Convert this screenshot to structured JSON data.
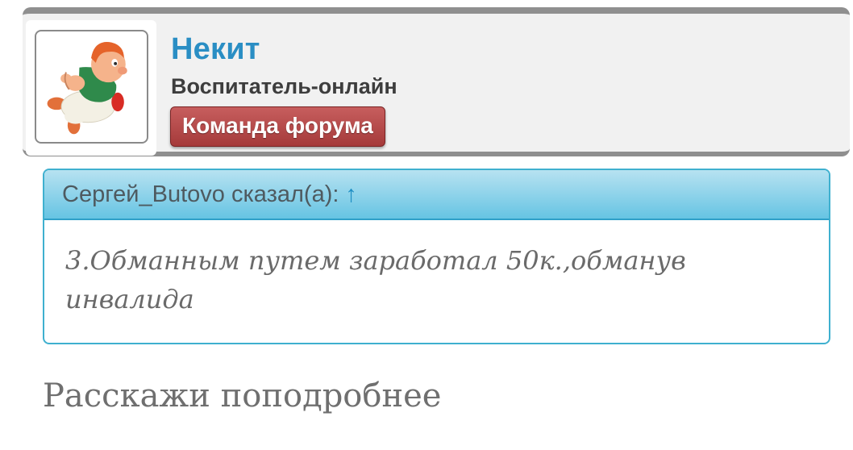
{
  "user": {
    "name": "Некит",
    "title": "Воспитатель-онлайн",
    "badge": "Команда форума"
  },
  "quote": {
    "author_line": "Сергей_Butovo сказал(а):",
    "arrow": "↑",
    "text": "3.Обманным путем заработал 50к.,обманув инвалида"
  },
  "reply": {
    "text": "Расскажи поподробнее"
  },
  "colors": {
    "username": "#2a8ec4",
    "badge": "#b14444",
    "quote_border": "#3fb0cf",
    "quote_header": "#66c4e3"
  },
  "icons": {
    "avatar": "cartoon-character-avatar",
    "arrow": "up-arrow-icon"
  }
}
